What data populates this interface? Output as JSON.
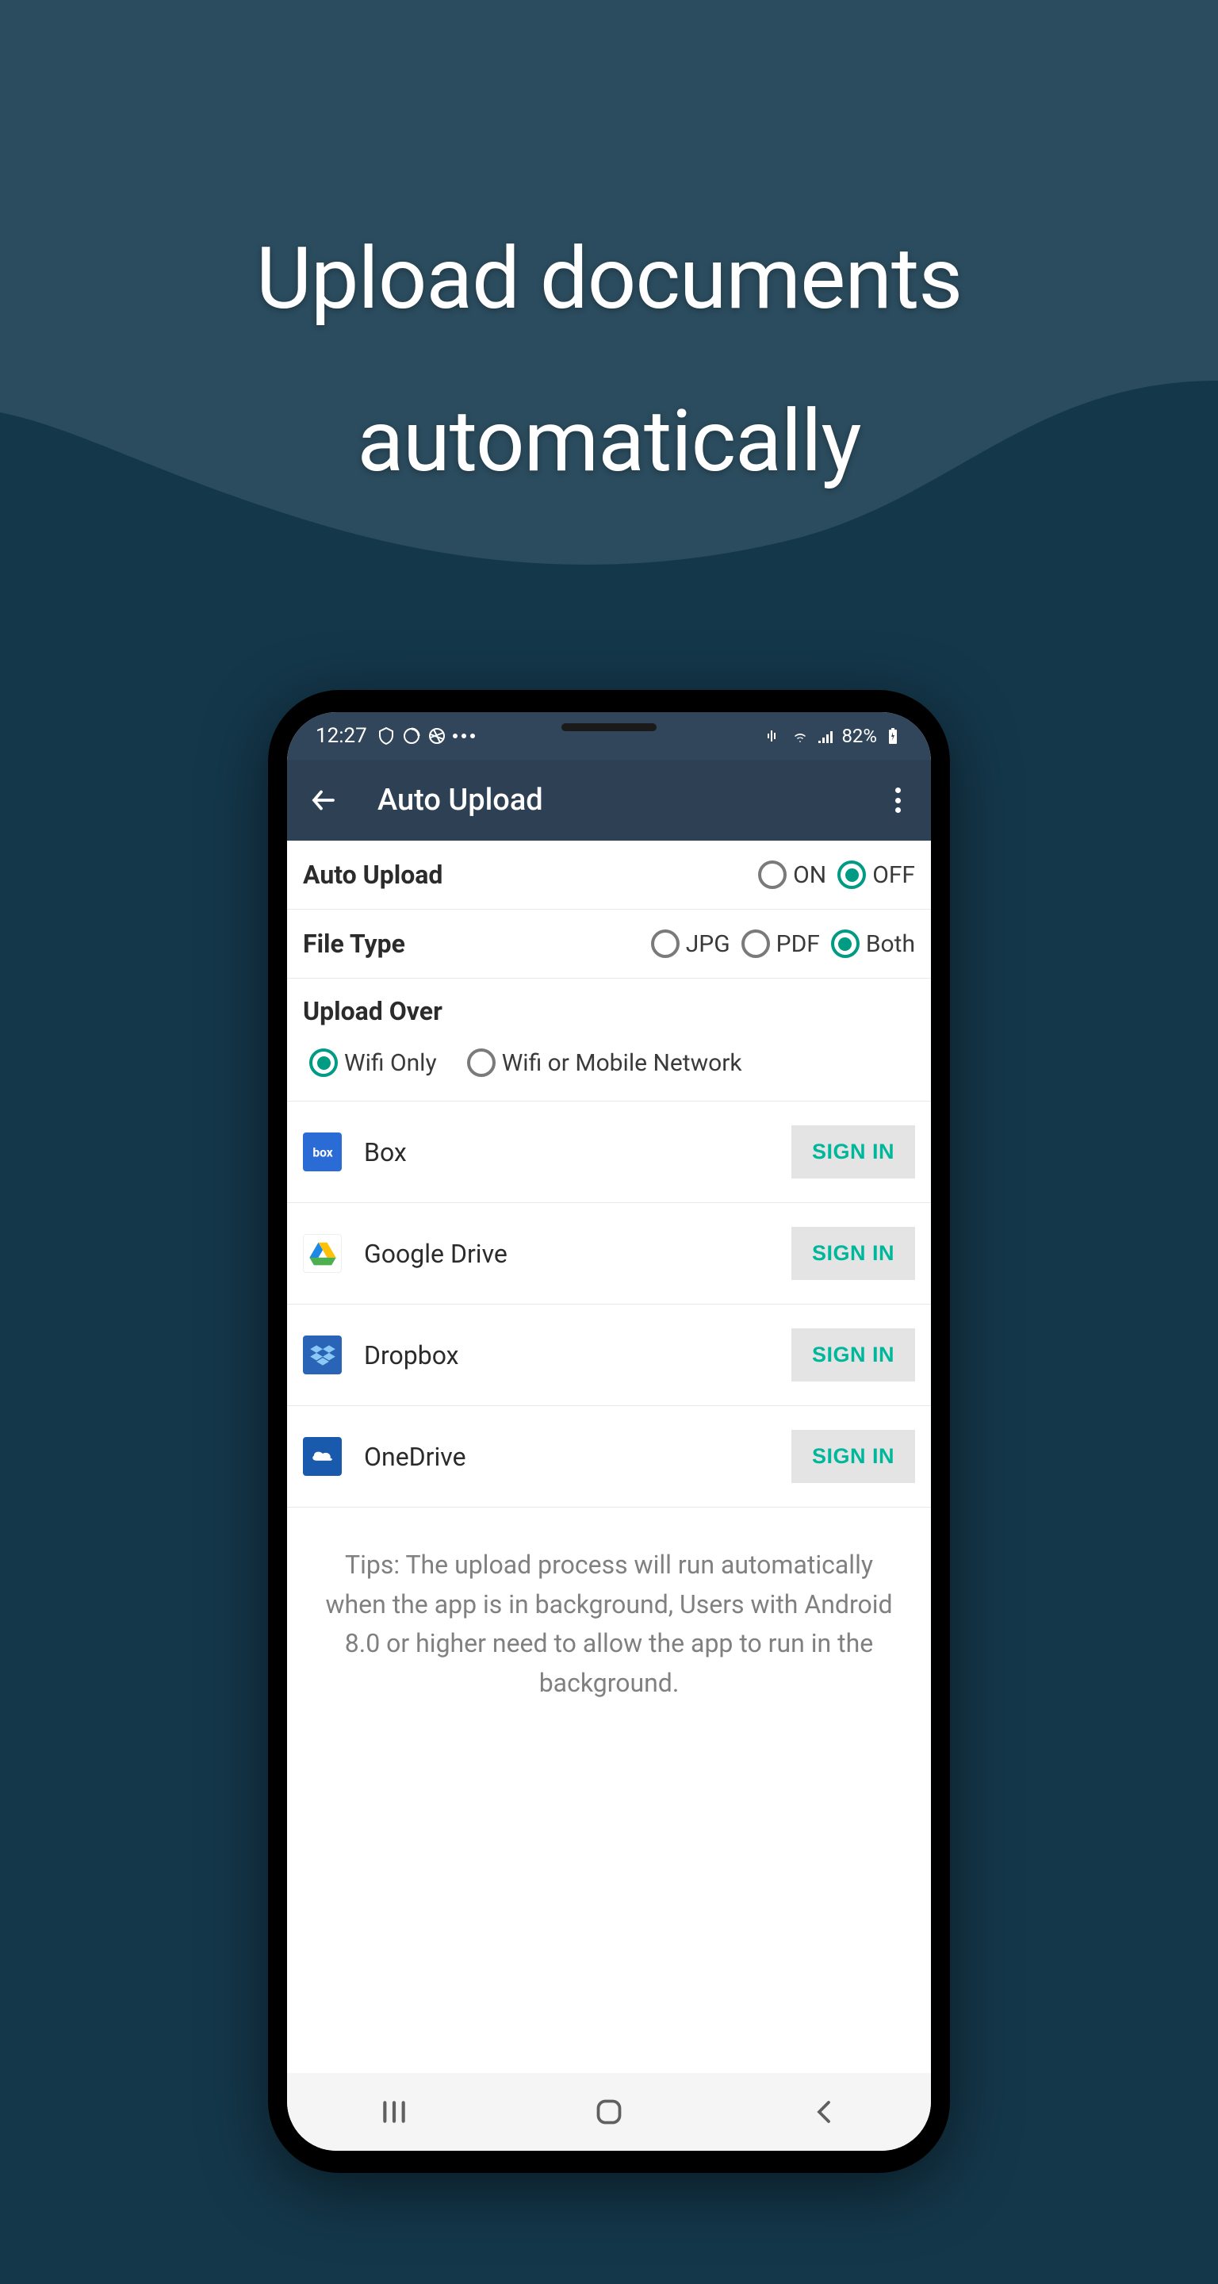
{
  "headline": "Upload documents automatically",
  "status_bar": {
    "time": "12:27",
    "battery": "82%"
  },
  "app_bar": {
    "title": "Auto Upload"
  },
  "settings": {
    "auto_upload": {
      "label": "Auto Upload",
      "options": [
        {
          "label": "ON",
          "checked": false
        },
        {
          "label": "OFF",
          "checked": true
        }
      ]
    },
    "file_type": {
      "label": "File Type",
      "options": [
        {
          "label": "JPG",
          "checked": false
        },
        {
          "label": "PDF",
          "checked": false
        },
        {
          "label": "Both",
          "checked": true
        }
      ]
    },
    "upload_over": {
      "label": "Upload Over",
      "options": [
        {
          "label": "Wifi Only",
          "checked": true
        },
        {
          "label": "Wifi or Mobile Network",
          "checked": false
        }
      ]
    }
  },
  "services": [
    {
      "name": "Box",
      "button": "SIGN IN",
      "icon": "box"
    },
    {
      "name": "Google Drive",
      "button": "SIGN IN",
      "icon": "gdrive"
    },
    {
      "name": "Dropbox",
      "button": "SIGN IN",
      "icon": "dropbox"
    },
    {
      "name": "OneDrive",
      "button": "SIGN IN",
      "icon": "onedrive"
    }
  ],
  "tips": "Tips: The upload process will run automatically when the app is in background, Users with Android 8.0 or higher need to allow the app to run in the background.",
  "colors": {
    "accent": "#009b83",
    "button_text": "#00b79b",
    "bg_dark": "#14374a",
    "bg_wave": "#2b4c5e",
    "appbar": "#2e4154",
    "statusbar": "#31465a"
  }
}
